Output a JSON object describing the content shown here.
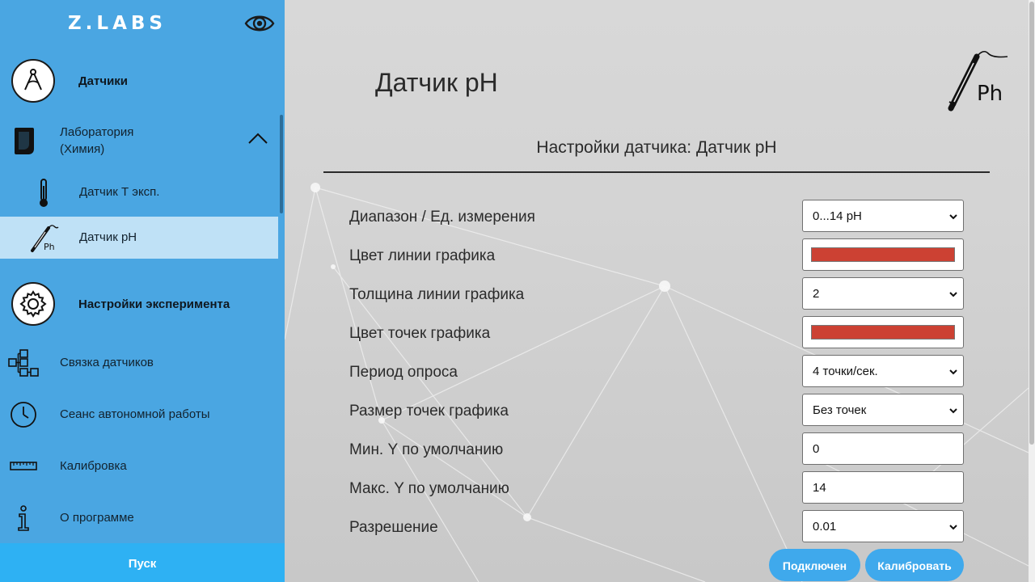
{
  "brand": {
    "logo_text": "Z.LABS"
  },
  "sidebar": {
    "sensors_category": "Датчики",
    "lab_group": {
      "label_line1": "Лаборатория",
      "label_line2": "(Химия)"
    },
    "sensor_items": [
      {
        "label": "Датчик Т эксп.",
        "icon": "thermometer-icon"
      },
      {
        "label": "Датчик pH",
        "icon": "ph-probe-icon"
      }
    ],
    "experiment_category": "Настройки эксперимента",
    "items": [
      {
        "label": "Связка датчиков",
        "icon": "sensor-link-icon"
      },
      {
        "label": "Сеанс автономной работы",
        "icon": "clock-icon"
      },
      {
        "label": "Калибровка",
        "icon": "ruler-icon"
      },
      {
        "label": "О программе",
        "icon": "info-icon"
      }
    ],
    "start_button": "Пуск"
  },
  "main": {
    "title": "Датчик pH",
    "probe_icon_text": "Ph",
    "section_title": "Настройки датчика: Датчик pH",
    "fields": [
      {
        "label": "Диапазон / Ед. измерения",
        "type": "select",
        "value": "0...14 pH"
      },
      {
        "label": "Цвет линии графика",
        "type": "color",
        "value": "#cc4133"
      },
      {
        "label": "Толщина линии графика",
        "type": "select",
        "value": "2"
      },
      {
        "label": "Цвет точек графика",
        "type": "color",
        "value": "#cc4133"
      },
      {
        "label": "Период опроса",
        "type": "select",
        "value": "4 точки/сек."
      },
      {
        "label": "Размер точек графика",
        "type": "select",
        "value": "Без точек"
      },
      {
        "label": "Мин. Y по умолчанию",
        "type": "input",
        "value": "0"
      },
      {
        "label": "Макс. Y по умолчанию",
        "type": "input",
        "value": "14"
      },
      {
        "label": "Разрешение",
        "type": "select",
        "value": "0.01"
      }
    ],
    "buttons": {
      "connected": "Подключен",
      "calibrate": "Калибровать"
    }
  },
  "colors": {
    "sidebar_bg": "#4aa6e2",
    "active_item_bg": "#bfe1f6",
    "start_button_bg": "#2eb1f3",
    "button_bg": "#3fa9ec",
    "graph_color": "#cc4133"
  }
}
